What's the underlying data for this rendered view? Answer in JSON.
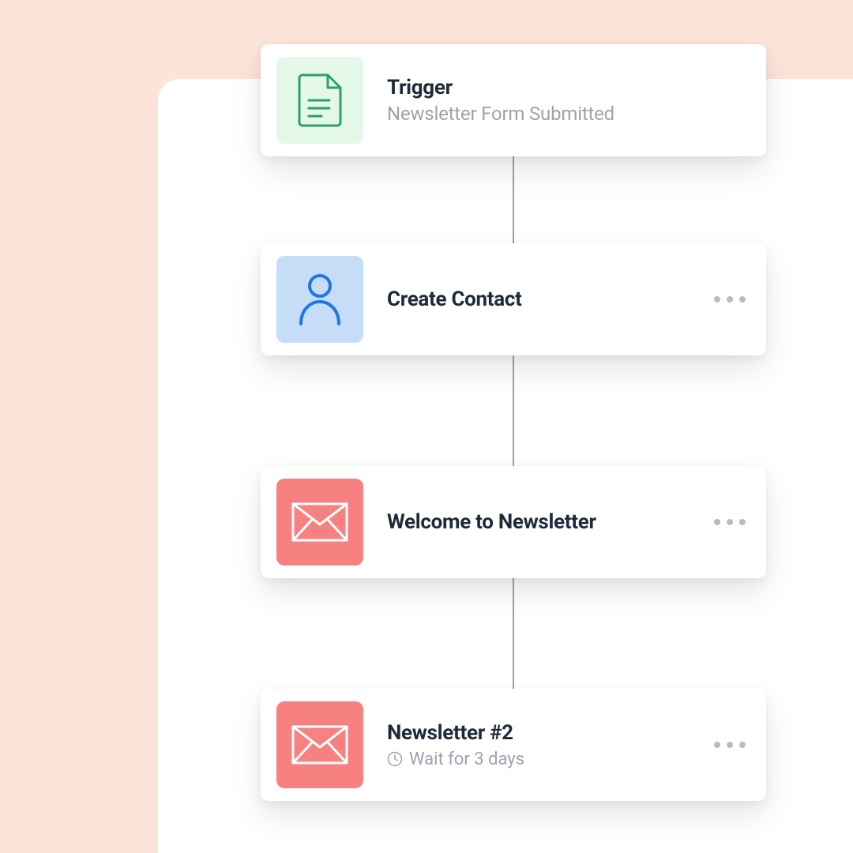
{
  "flow": {
    "steps": [
      {
        "title": "Trigger",
        "subtitle": "Newsletter Form Submitted",
        "icon": "document-icon",
        "icon_bg": "green",
        "has_more": false,
        "wait": null
      },
      {
        "title": "Create Contact",
        "subtitle": null,
        "icon": "person-icon",
        "icon_bg": "blue",
        "has_more": true,
        "wait": null
      },
      {
        "title": "Welcome to Newsletter",
        "subtitle": null,
        "icon": "mail-icon",
        "icon_bg": "red",
        "has_more": true,
        "wait": null
      },
      {
        "title": "Newsletter #2",
        "subtitle": null,
        "icon": "mail-icon",
        "icon_bg": "red",
        "has_more": true,
        "wait": "Wait for 3 days"
      }
    ]
  },
  "colors": {
    "page_bg": "#fde4d9",
    "card_bg": "#ffffff",
    "text_primary": "#1e2a3a",
    "text_secondary": "#9ba3af",
    "icon_green_bg": "#e4f8ea",
    "icon_blue_bg": "#c5ddf7",
    "icon_red_bg": "#f78080",
    "connector": "#9aa3ad"
  }
}
